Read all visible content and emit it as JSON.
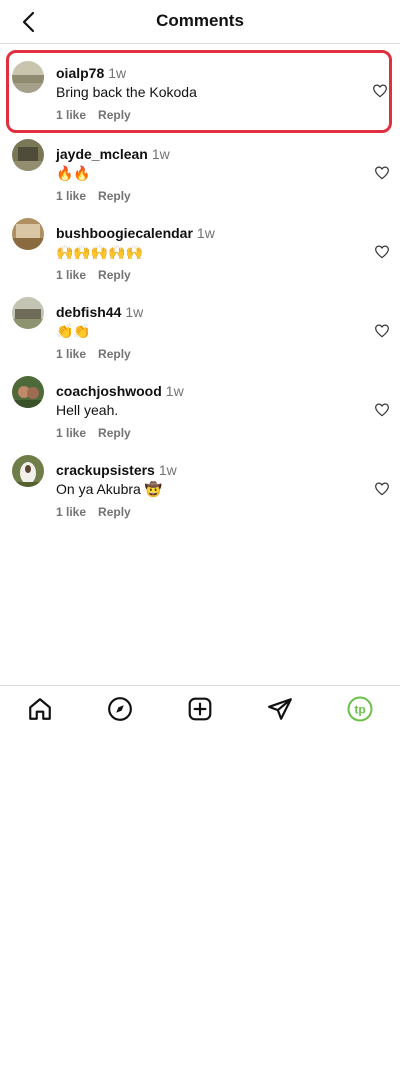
{
  "header": {
    "title": "Comments"
  },
  "comments": [
    {
      "username": "oialp78",
      "time": "1w",
      "text": "Bring back the Kokoda",
      "likes": "1 like",
      "reply": "Reply",
      "highlighted": true,
      "avatar_color": "#a9a58c"
    },
    {
      "username": "jayde_mclean",
      "time": "1w",
      "text": "🔥🔥",
      "likes": "1 like",
      "reply": "Reply",
      "highlighted": false,
      "avatar_color": "#6d6a53"
    },
    {
      "username": "bushboogiecalendar",
      "time": "1w",
      "text": "🙌🙌🙌🙌🙌",
      "likes": "1 like",
      "reply": "Reply",
      "highlighted": false,
      "avatar_color": "#a68458"
    },
    {
      "username": "debfish44",
      "time": "1w",
      "text": "👏👏",
      "likes": "1 like",
      "reply": "Reply",
      "highlighted": false,
      "avatar_color": "#8b8b73"
    },
    {
      "username": "coachjoshwood",
      "time": "1w",
      "text": "Hell yeah.",
      "likes": "1 like",
      "reply": "Reply",
      "highlighted": false,
      "avatar_color": "#5e7148"
    },
    {
      "username": "crackupsisters",
      "time": "1w",
      "text": "On ya Akubra 🤠",
      "likes": "1 like",
      "reply": "Reply",
      "highlighted": false,
      "avatar_color": "#7f8a59"
    }
  ],
  "nav": {
    "items": [
      "home-icon",
      "explore-icon",
      "create-icon",
      "send-icon",
      "profile-icon"
    ],
    "profile_initials": "tp",
    "profile_color": "#6cc04a"
  }
}
